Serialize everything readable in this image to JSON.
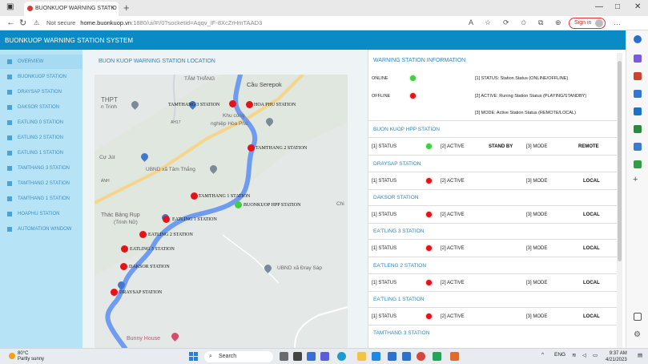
{
  "browser": {
    "tab_title": "BUONKUOP WARNING STATIO",
    "tab_close": "×",
    "new_tab": "+",
    "not_secure": "Not secure",
    "url_host": "home.buonkuop.vn",
    "url_path": ":1880/ui/#!/0?socketid=Aqqv_IF-8XcZrHmTAAD3",
    "sign_in": "Sign in",
    "window_controls": [
      "—",
      "□",
      "✕"
    ]
  },
  "app": {
    "header_title": "BUONKUOP WARNING STATION SYSTEM",
    "sidebar": [
      {
        "label": "OVERVIEW",
        "active": true
      },
      {
        "label": "BUONKUOP STATION"
      },
      {
        "label": "DRAYSAP STATION"
      },
      {
        "label": "DAKSOR STATION"
      },
      {
        "label": "EATLING 0 STATION"
      },
      {
        "label": "EATLING 2 STATION"
      },
      {
        "label": "EATLING 1 STATION"
      },
      {
        "label": "TAMTHANG 3 STATION"
      },
      {
        "label": "TAMTHANG 2 STATION"
      },
      {
        "label": "TAMTHANG 1 STATION"
      },
      {
        "label": "HOAPHU STATION"
      },
      {
        "label": "AUTOMATION WINDOW"
      }
    ],
    "map": {
      "title": "BUON KUOP WARNING STATION LOCATION",
      "place_labels": [
        "TÂM THẮNG",
        "Cầu Serepok",
        "THPT",
        "n Trinh",
        "Khu công",
        "nghiệp Hòa Phú",
        "Cự Jút",
        "UBND xã Tâm Thắng",
        "ÁNH",
        "Chi",
        "Thác Bảng Rụp",
        "(Trinh Nữ)",
        "UBND xã Đray Sáp",
        "Bunny House",
        "AH17"
      ],
      "stations": [
        {
          "name": "TAMTHANG 3 STATION",
          "status": "red"
        },
        {
          "name": "HOA PHU STATION",
          "status": "red"
        },
        {
          "name": "TAMTHANG 2 STATION",
          "status": "red"
        },
        {
          "name": "TAMTHANG 1 STATION",
          "status": "red"
        },
        {
          "name": "BUONKUOP HPP STATION",
          "status": "green"
        },
        {
          "name": "EATLING 1 STATION",
          "status": "red"
        },
        {
          "name": "EATLING 2 STATION",
          "status": "red"
        },
        {
          "name": "EATLING 3 STATION",
          "status": "red"
        },
        {
          "name": "DAKSOR STATION",
          "status": "red"
        },
        {
          "name": "DRAYSAP STATION",
          "status": "red"
        }
      ]
    },
    "info": {
      "title": "WARNING STATION INFORMATION",
      "legend": {
        "online": "ONLINE",
        "offline": "OFFLINE",
        "status_desc": "[1] STATUS: Station Status (ONLINE/OFFLINE)",
        "active_desc": "[2] ACTIVE: Runing Station Status (PLAYING/STANDBY)",
        "mode_desc": "[3] MODE: Active Station Status (REMOTE/LOCAL)"
      },
      "labels": {
        "status": "[1] STATUS",
        "active": "[2] ACTIVE",
        "mode": "[3] MODE"
      },
      "stations": [
        {
          "name": "BUON KUOP HPP STATION",
          "status": "green",
          "active": "STAND BY",
          "mode": "REMOTE"
        },
        {
          "name": "DRAYSAP STATION",
          "status": "red",
          "active": "",
          "mode": "LOCAL"
        },
        {
          "name": "DAKSOR STATION",
          "status": "red",
          "active": "",
          "mode": "LOCAL"
        },
        {
          "name": "EA'TLING 3 STATION",
          "status": "red",
          "active": "",
          "mode": "LOCAL"
        },
        {
          "name": "EA'TLENG 2 STATION",
          "status": "red",
          "active": "",
          "mode": "LOCAL"
        },
        {
          "name": "EA'TLING 1 STATION",
          "status": "red",
          "active": "",
          "mode": "LOCAL"
        },
        {
          "name": "TAMTHANG 3 STATION",
          "status": "red",
          "active": "",
          "mode": ""
        }
      ]
    }
  },
  "taskbar": {
    "temp": "80°C",
    "weather": "Partly sunny",
    "search": "Search",
    "lang": "ENG",
    "time": "9:37 AM",
    "date": "4/21/2023"
  },
  "colors": {
    "header": "#0a8bc6",
    "sidebar": "#b7e3f6",
    "online": "#3fcf3f",
    "offline": "#e3131a",
    "title": "#2f85be"
  }
}
